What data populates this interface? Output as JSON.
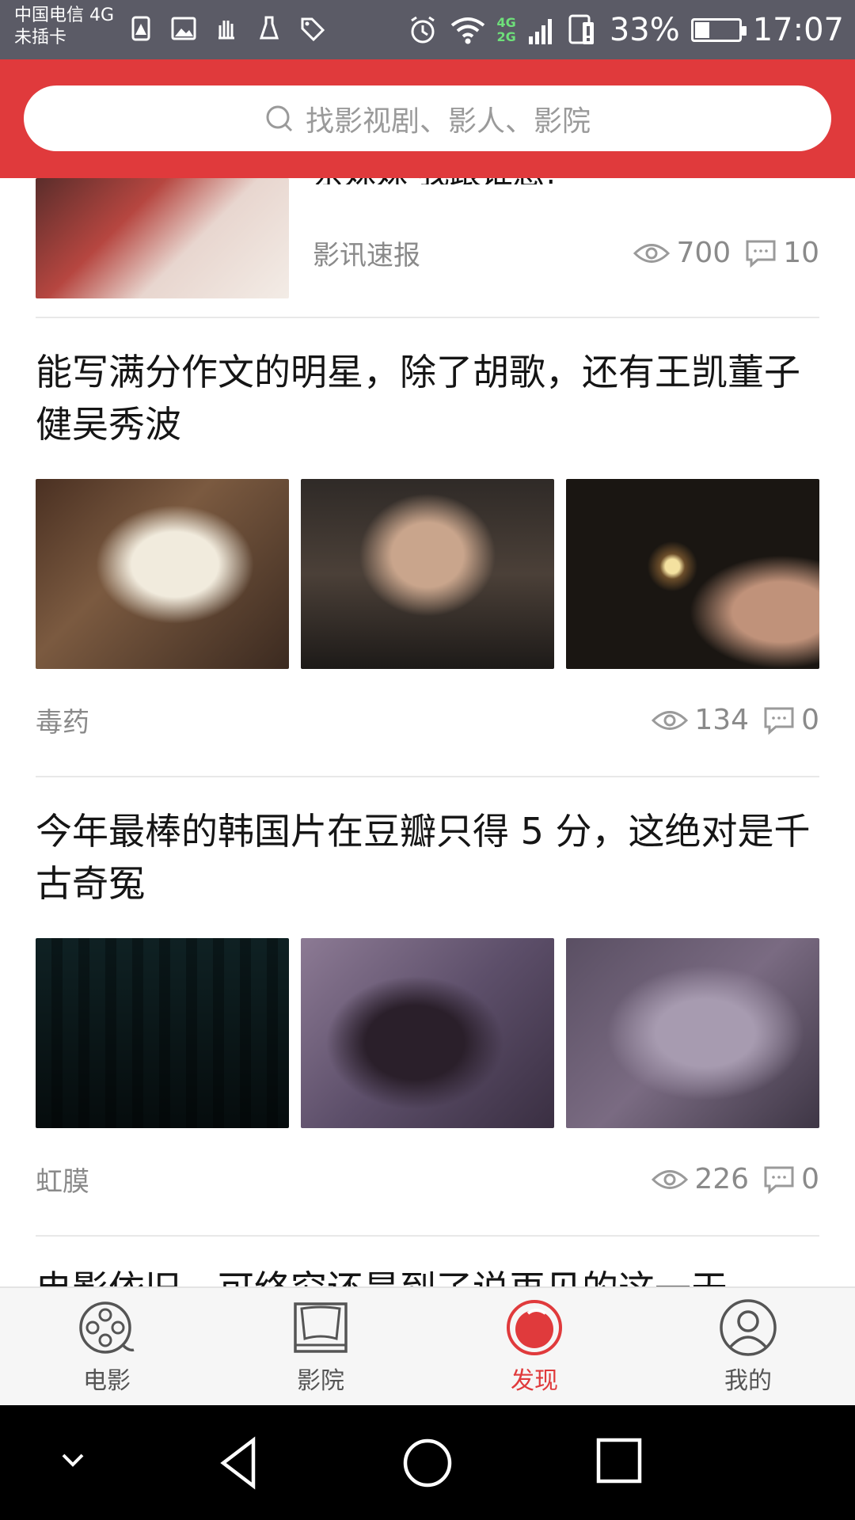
{
  "status_bar": {
    "carrier_line1": "中国电信 4G",
    "carrier_line2": "未插卡",
    "net_4g": "4G",
    "net_2g": "2G",
    "battery_percent": "33%",
    "battery_level": 0.33,
    "time": "17:07"
  },
  "search": {
    "placeholder": "找影视剧、影人、影院"
  },
  "feed": {
    "top_card": {
      "title_partial": "亲妹妹 我跟谁急!",
      "tag": "影讯速报",
      "views": "700",
      "comments": "10"
    },
    "articles": [
      {
        "title": "能写满分作文的明星，除了胡歌，还有王凯董子健吴秀波",
        "tag": "毒药",
        "views": "134",
        "comments": "0"
      },
      {
        "title": "今年最棒的韩国片在豆瓣只得 5 分，这绝对是千古奇冤",
        "tag": "虹膜",
        "views": "226",
        "comments": "0"
      }
    ],
    "peek_title": "电影依旧，可终究还是到了说再见的这一天"
  },
  "tabbar": {
    "tabs": [
      {
        "label": "电影",
        "icon": "film-reel-icon"
      },
      {
        "label": "影院",
        "icon": "cinema-screen-icon"
      },
      {
        "label": "发现",
        "icon": "discover-icon"
      },
      {
        "label": "我的",
        "icon": "profile-icon"
      }
    ],
    "active_index": 2
  },
  "colors": {
    "brand_red": "#e03a3c",
    "text_gray": "#8a8a8a"
  }
}
